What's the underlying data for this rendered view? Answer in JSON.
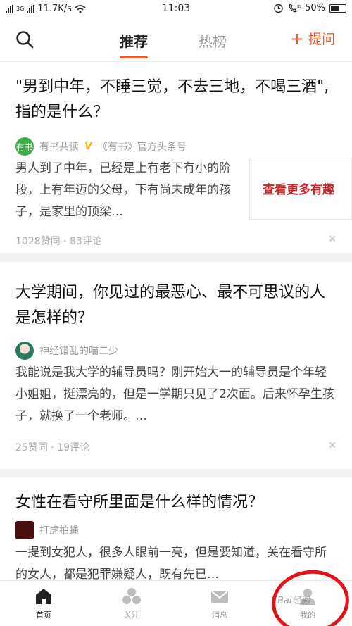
{
  "status": {
    "network": "11.7K/s",
    "time": "11:03",
    "battery": "50%"
  },
  "nav": {
    "tab_recommend": "推荐",
    "tab_hot": "热榜",
    "ask_label": "提问"
  },
  "cards": [
    {
      "title": "\"男到中年，不睡三觉，不去三地，不喝三酒\",指的是什么？",
      "author": "有书共读",
      "author_avatar_text": "有书",
      "author_suffix": "《有书》官方头条号",
      "excerpt": "男人到了中年，已经是上有老下有小的阶段，上有年迈的父母，下有尚未成年的孩子，是家里的顶梁…",
      "ad_text": "查看更多有趣",
      "likes": "1028赞同",
      "comments": "83评论"
    },
    {
      "title": "大学期间，你见过的最恶心、最不可思议的人是怎样的？",
      "author": "神经错乱的喵二少",
      "excerpt": "我能说是我大学的辅导员吗？刚开始大一的辅导员是个年轻小姐姐，挺漂亮的，但是一学期只见了2次面。后来怀孕生孩子，就换了一个老师。…",
      "likes": "25赞同",
      "comments": "19评论"
    },
    {
      "title": "女性在看守所里面是什么样的情况？",
      "author": "打虎拍蝇",
      "excerpt": "一提到女犯人，很多人眼前一亮，但是要知道，关在看守所的女人，都是犯罪嫌疑人，既有先已…"
    }
  ],
  "bottom_tabs": {
    "home": "首页",
    "follow": "关注",
    "messages": "消息",
    "me": "我的"
  },
  "watermark": "Bai经验",
  "colors": {
    "accent": "#f05a28",
    "annotation_circle": "#e5101a"
  }
}
